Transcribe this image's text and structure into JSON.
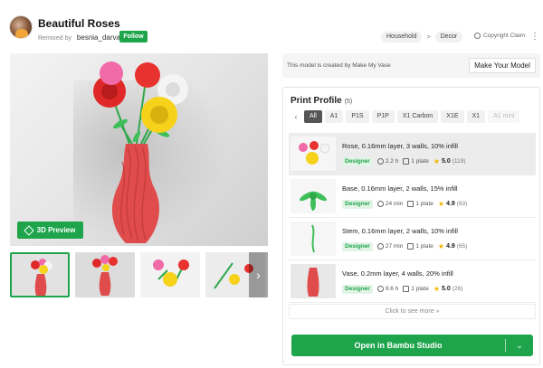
{
  "header": {
    "title": "Beautiful Roses",
    "remixed_by_label": "Remixed by",
    "author": "besnia_darvar",
    "follow_label": "Follow",
    "breadcrumbs": [
      "Household",
      "Decor"
    ],
    "breadcrumb_separator": ">",
    "copyright_label": "Copyright Claim",
    "more_icon": "more-vertical-icon"
  },
  "gallery": {
    "preview_label": "3D Preview",
    "preview_icon": "cube-icon",
    "next_icon": "chevron-right-icon"
  },
  "creator_banner": {
    "text": "This model is created by Make My Vase",
    "button_label": "Make Your Model"
  },
  "print_profile": {
    "title": "Print Profile",
    "count": "(5)",
    "filters": [
      "All",
      "A1",
      "P1S",
      "P1P",
      "X1 Carbon",
      "X1E",
      "X1",
      "A1 mini"
    ],
    "active_filter": "All",
    "profiles": [
      {
        "name": "Rose, 0.16mm layer, 3 walls, 10% infill",
        "badge": "Designer",
        "time": "2.2 h",
        "plates": "1 plate",
        "rating": "5.0",
        "reviews": "(119)"
      },
      {
        "name": "Base, 0.16mm layer, 2 walls, 15% infill",
        "badge": "Designer",
        "time": "24 min",
        "plates": "1 plate",
        "rating": "4.9",
        "reviews": "(63)"
      },
      {
        "name": "Stem, 0.16mm layer, 2 walls, 10% infill",
        "badge": "Designer",
        "time": "27 min",
        "plates": "1 plate",
        "rating": "4.9",
        "reviews": "(65)"
      },
      {
        "name": "Vase, 0.2mm layer, 4 walls, 20% infill",
        "badge": "Designer",
        "time": "9.6 h",
        "plates": "1 plate",
        "rating": "5.0",
        "reviews": "(28)"
      }
    ],
    "see_more_label": "Click to see more",
    "open_button_label": "Open in Bambu Studio"
  },
  "colors": {
    "accent": "#1ea54c",
    "vase": "#e04b4b",
    "star": "#f5b400"
  }
}
